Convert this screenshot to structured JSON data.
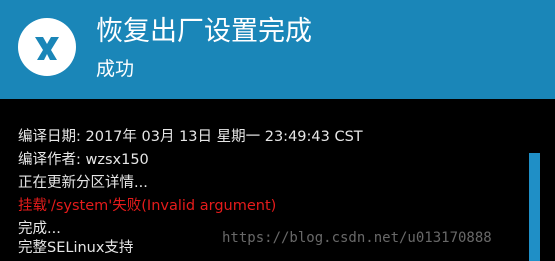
{
  "header": {
    "title": "恢复出厂设置完成",
    "subtitle": "成功",
    "background_color": "#1a86b8",
    "logo_icon": "twrp-logo-icon"
  },
  "console": {
    "lines": [
      {
        "text": "编译日期:  2017年 03月 13日 星期一 23:49:43 CST",
        "status": "normal"
      },
      {
        "text": "编译作者:  wzsx150",
        "status": "normal"
      },
      {
        "text": "正在更新分区详情...",
        "status": "normal"
      },
      {
        "text": "挂载'/system'失败(Invalid argument)",
        "status": "error"
      },
      {
        "text": "完成...",
        "status": "normal"
      },
      {
        "text": "完整SELinux支持",
        "status": "normal"
      }
    ],
    "error_color": "#e51b1b",
    "text_color": "#e6e6e6"
  },
  "watermark": {
    "text": "https://blog.csdn.net/u013170888"
  }
}
